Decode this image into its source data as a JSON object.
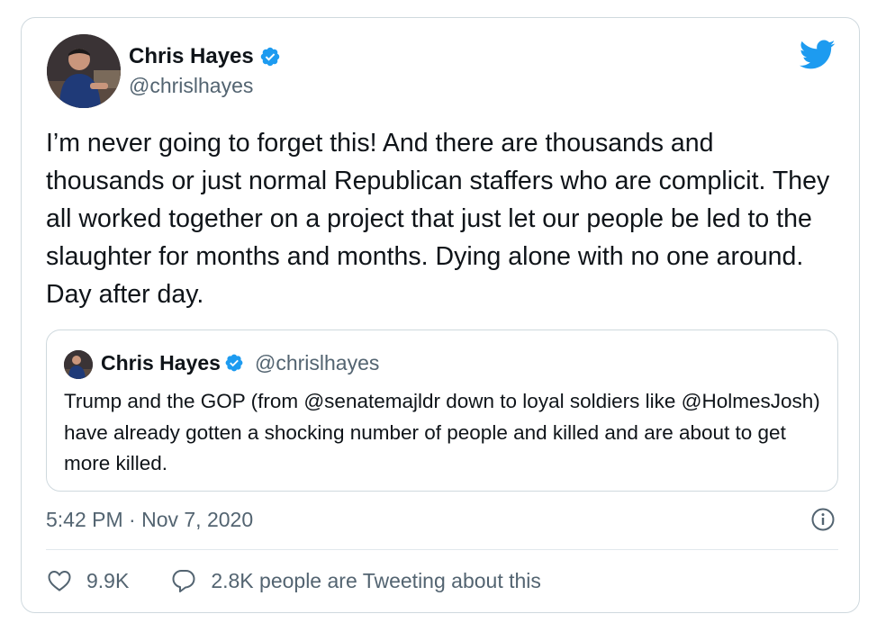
{
  "author": {
    "name": "Chris Hayes",
    "handle": "@chrislhayes",
    "verified": true
  },
  "tweet": {
    "text": "I’m never going to forget this! And there are thousands and thousands or just normal Republican staffers who are complicit. They all worked together on a project that just let our people be led to the slaughter for months and months. Dying alone with no one around. Day after day."
  },
  "quoted_tweet": {
    "name": "Chris Hayes",
    "handle": "@chrislhayes",
    "verified": true,
    "text": "Trump and the GOP (from @senatemajldr down to loyal soldiers like @HolmesJosh) have already gotten a shocking number of people and killed and are about to get more killed."
  },
  "meta": {
    "timestamp": "5:42 PM · Nov 7, 2020"
  },
  "stats": {
    "likes": "9.9K",
    "tweeting": "2.8K people are Tweeting about this"
  },
  "colors": {
    "text": "#0f1419",
    "secondary": "#536471",
    "border": "#cfd9de",
    "twitter_blue": "#1d9bf0"
  },
  "icons": [
    "verified-badge-icon",
    "twitter-bird-icon",
    "info-icon",
    "heart-icon",
    "speech-bubble-icon"
  ]
}
